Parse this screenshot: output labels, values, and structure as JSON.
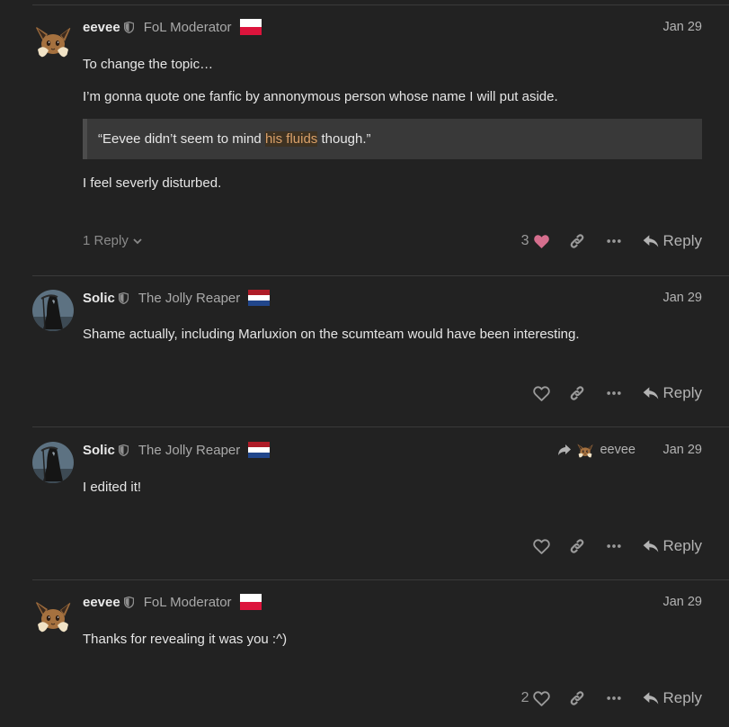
{
  "posts": [
    {
      "username": "eevee",
      "user_title": "FoL Moderator",
      "flag": "poland",
      "date": "Jan 29",
      "paragraphs": [
        "To change the topic…",
        "I’m gonna quote one fanfic by annonymous person whose name I will put aside."
      ],
      "quote": {
        "before": "“Eevee didn’t seem to mind ",
        "highlight": "his fluids",
        "after": " though.”"
      },
      "closing": "I feel severly disturbed.",
      "replies_label": "1 Reply",
      "like_count": "3",
      "reply_label": "Reply"
    },
    {
      "username": "Solic",
      "user_title": "The Jolly Reaper",
      "flag": "netherlands",
      "date": "Jan 29",
      "paragraphs": [
        "Shame actually, including Marluxion on the scumteam would have been interesting."
      ],
      "reply_label": "Reply"
    },
    {
      "username": "Solic",
      "user_title": "The Jolly Reaper",
      "flag": "netherlands",
      "date": "Jan 29",
      "reply_to": "eevee",
      "paragraphs": [
        "I edited it!"
      ],
      "reply_label": "Reply"
    },
    {
      "username": "eevee",
      "user_title": "FoL Moderator",
      "flag": "poland",
      "date": "Jan 29",
      "paragraphs": [
        "Thanks for revealing it was you :^)"
      ],
      "like_count": "2",
      "reply_label": "Reply"
    }
  ],
  "colors": {
    "background": "#222222",
    "liked_heart": "#d56e8d",
    "quote_background": "#393939",
    "highlight_text": "#d9a069"
  }
}
